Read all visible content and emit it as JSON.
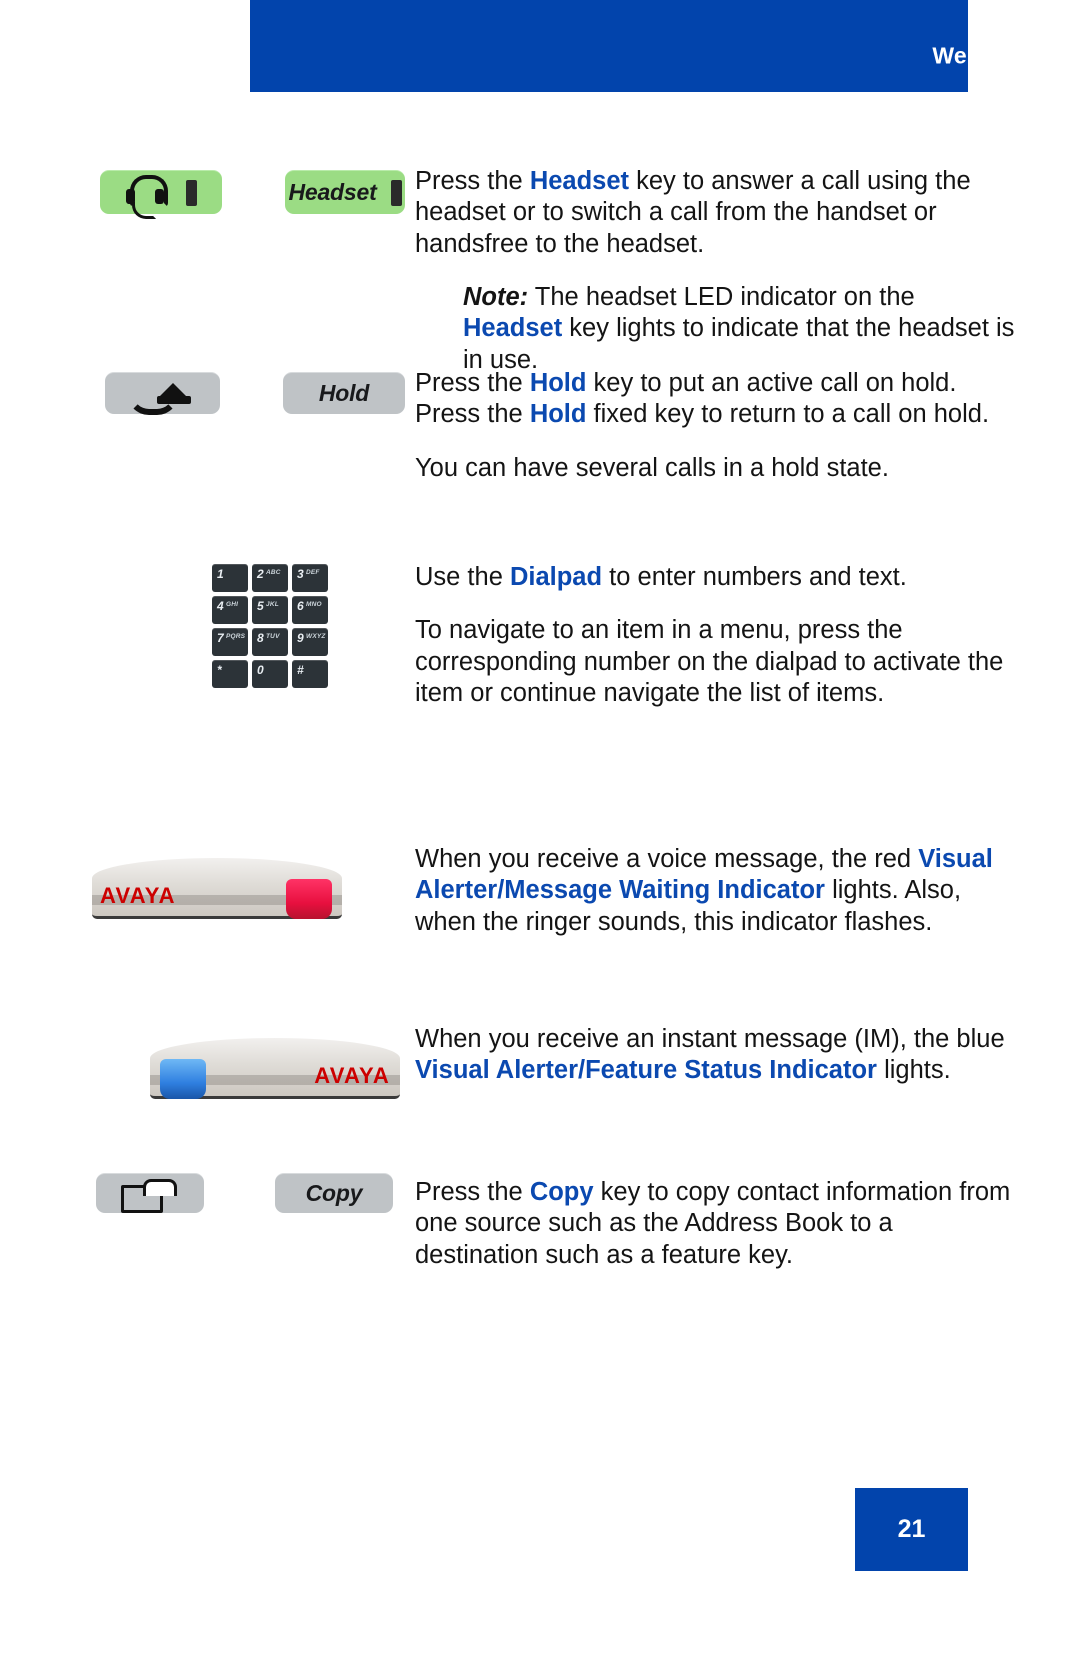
{
  "header": {
    "title": "Welcome",
    "bar_color": "#0244AC"
  },
  "footer": {
    "page_number": "21",
    "bar_color": "#0244AC"
  },
  "accent_color": "#0B49B0",
  "sections": [
    {
      "id": "headset",
      "icon_key_label": "",
      "text_key_label": "Headset",
      "key_color": "#9BDC84",
      "paragraphs": [
        {
          "parts": [
            {
              "t": "Press the ",
              "k": false
            },
            {
              "t": "Headset",
              "k": true
            },
            {
              "t": " key to answer a call using the headset or to switch a call from the handset or handsfree to the headset.",
              "k": false
            }
          ]
        }
      ],
      "note": {
        "label": "Note:",
        "parts": [
          {
            "t": " The headset LED indicator on the ",
            "k": false
          },
          {
            "t": "Headset",
            "k": true
          },
          {
            "t": " key lights to indicate that the headset is in use.",
            "k": false
          }
        ]
      }
    },
    {
      "id": "hold",
      "icon_key_label": "",
      "text_key_label": "Hold",
      "key_color": "#BFC3C6",
      "paragraphs": [
        {
          "parts": [
            {
              "t": "Press the ",
              "k": false
            },
            {
              "t": "Hold",
              "k": true
            },
            {
              "t": " key to put an active call on hold. Press the ",
              "k": false
            },
            {
              "t": "Hold",
              "k": true
            },
            {
              "t": " fixed key to return to a call on hold.",
              "k": false
            }
          ]
        },
        {
          "parts": [
            {
              "t": "You can have several calls in a hold state.",
              "k": false
            }
          ]
        }
      ]
    },
    {
      "id": "dialpad",
      "paragraphs": [
        {
          "parts": [
            {
              "t": "Use the ",
              "k": false
            },
            {
              "t": "Dialpad",
              "k": true
            },
            {
              "t": " to enter numbers and text.",
              "k": false
            }
          ]
        },
        {
          "parts": [
            {
              "t": "To navigate to an item in a menu, press the corresponding number on the dialpad to activate the item or continue navigate the list of items.",
              "k": false
            }
          ]
        }
      ]
    },
    {
      "id": "visual-alerter-mwi",
      "paragraphs": [
        {
          "parts": [
            {
              "t": "When you receive a voice message, the red ",
              "k": false
            },
            {
              "t": "Visual Alerter/Message Waiting Indicator",
              "k": true
            },
            {
              "t": " lights. Also, when the ringer sounds, this indicator flashes.",
              "k": false
            }
          ]
        }
      ]
    },
    {
      "id": "visual-alerter-feature-status",
      "paragraphs": [
        {
          "parts": [
            {
              "t": "When you receive an instant message (IM), the blue ",
              "k": false
            },
            {
              "t": "Visual Alerter/Feature Status Indicator",
              "k": true
            },
            {
              "t": " lights.",
              "k": false
            }
          ]
        }
      ]
    },
    {
      "id": "copy",
      "icon_key_label": "",
      "text_key_label": "Copy",
      "key_color": "#BFC3C6",
      "paragraphs": [
        {
          "parts": [
            {
              "t": "Press the ",
              "k": false
            },
            {
              "t": "Copy",
              "k": true
            },
            {
              "t": " key to copy contact information from one source such as the Address Book to a destination such as a feature key.",
              "k": false
            }
          ]
        }
      ]
    }
  ],
  "keycaps": {
    "headset_label": "Headset",
    "hold_label": "Hold",
    "copy_label": "Copy"
  },
  "dialpad_keys": [
    {
      "num": "1",
      "letters": ""
    },
    {
      "num": "2",
      "letters": "ABC"
    },
    {
      "num": "3",
      "letters": "DEF"
    },
    {
      "num": "4",
      "letters": "GHI"
    },
    {
      "num": "5",
      "letters": "JKL"
    },
    {
      "num": "6",
      "letters": "MNO"
    },
    {
      "num": "7",
      "letters": "PQRS"
    },
    {
      "num": "8",
      "letters": "TUV"
    },
    {
      "num": "9",
      "letters": "WXYZ"
    },
    {
      "num": "*",
      "letters": ""
    },
    {
      "num": "0",
      "letters": ""
    },
    {
      "num": "#",
      "letters": ""
    }
  ],
  "phone_photos": {
    "brand": "AVAYA",
    "red_indicator_color": "#E8103F",
    "blue_indicator_color": "#2F7FE0"
  }
}
